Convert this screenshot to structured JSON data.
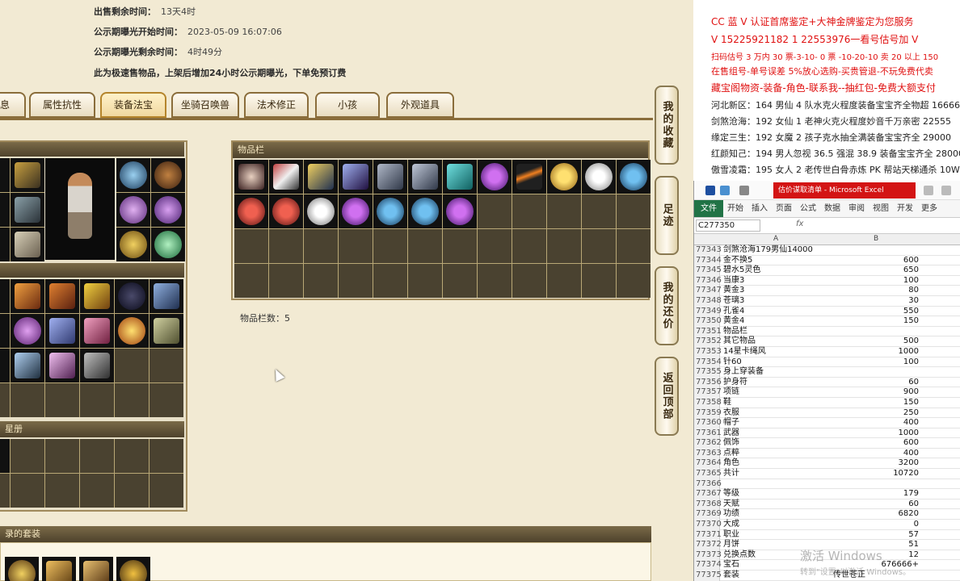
{
  "info": {
    "remain_label": "出售剩余时间：",
    "remain_value": "13天4时",
    "start_label": "公示期曝光开始时间：",
    "start_value": "2023-05-09 16:07:06",
    "left_label": "公示期曝光剩余时间：",
    "left_value": "4时49分",
    "note": "此为极速售物品，上架后增加24小时公示期曝光，下单免预订费"
  },
  "tabs": [
    "息",
    "属性抗性",
    "装备法宝",
    "坐骑召唤兽",
    "法术修正",
    "小孩",
    "外观道具"
  ],
  "active_tab": "装备法宝",
  "panels": {
    "items_title": "物品栏",
    "item_count": "物品栏数：5",
    "album_title": "星册",
    "suits_title": "录的套装"
  },
  "side_buttons": [
    "我的收藏",
    "足迹",
    "我的还价",
    "返回顶部"
  ],
  "ads": [
    {
      "text": "CC 蓝 V 认证首席鉴定+大神金牌鉴定为您服务",
      "color": "red"
    },
    {
      "text": "V 15225921182      1    22553976一看号估号加 V",
      "color": "red"
    },
    {
      "text": "扫码估号 3 万内 30 票-3-10-  0 票 -10-20-10  卖 20 以上 150",
      "color": "red"
    },
    {
      "text": "在售组号-单号误差 5%放心选购-买贵管退-不玩免费代卖",
      "color": "red"
    },
    {
      "text": "藏宝阁物资-装备-角色-联系我--抽红包-免费大额支付",
      "color": "red"
    },
    {
      "text": "河北新区：164 男仙 4 队水克火程度装备宝宝齐全物超 16666",
      "color": "dark"
    },
    {
      "text": "剑煞沧海：192 女仙 1 老神火克火程度妙音千万亲密 22555",
      "color": "dark"
    },
    {
      "text": "缘定三生：192 女魔 2 孩子克水抽全满装备宝宝齐全 29000",
      "color": "dark"
    },
    {
      "text": "红颜知己：194 男人忽视 36.5 强混 38.9 装备宝宝齐全 28000",
      "color": "dark"
    },
    {
      "text": "傲雪凌霜：195 女人 2 老传世白骨赤炼 PK 帮站天梯通杀 10W",
      "color": "dark"
    }
  ],
  "excel": {
    "title_bar": "估价谋取清单 - Microsoft Excel",
    "ribbon_tabs": [
      "文件",
      "开始",
      "插入",
      "页面",
      "公式",
      "数据",
      "审阅",
      "视图",
      "开发",
      "更多"
    ],
    "name_box": "C277350",
    "fx": "fx",
    "col_a": "A",
    "col_b": "B",
    "rows": [
      {
        "n": "77343",
        "a": "剑煞沧海179男仙14000",
        "b": ""
      },
      {
        "n": "77344",
        "a": "金不换5",
        "b": "600"
      },
      {
        "n": "77345",
        "a": "碧水5灵色",
        "b": "650"
      },
      {
        "n": "77346",
        "a": "当康3",
        "b": "100"
      },
      {
        "n": "77347",
        "a": "黄金3",
        "b": "80"
      },
      {
        "n": "77348",
        "a": "苍璃3",
        "b": "30"
      },
      {
        "n": "77349",
        "a": "孔雀4",
        "b": "550"
      },
      {
        "n": "77350",
        "a": "黄金4",
        "b": "150"
      },
      {
        "n": "77351",
        "a": "物品栏",
        "b": ""
      },
      {
        "n": "77352",
        "a": "其它物品",
        "b": "500"
      },
      {
        "n": "77353",
        "a": "14星卡绳风",
        "b": "1000"
      },
      {
        "n": "77354",
        "a": "针60",
        "b": "100"
      },
      {
        "n": "77355",
        "a": "身上穿装备",
        "b": ""
      },
      {
        "n": "77356",
        "a": "护身符",
        "b": "60"
      },
      {
        "n": "77357",
        "a": "项链",
        "b": "900"
      },
      {
        "n": "77358",
        "a": "鞋",
        "b": "150"
      },
      {
        "n": "77359",
        "a": "衣服",
        "b": "250"
      },
      {
        "n": "77360",
        "a": "帽子",
        "b": "400"
      },
      {
        "n": "77361",
        "a": "武器",
        "b": "1000"
      },
      {
        "n": "77362",
        "a": "佩饰",
        "b": "600"
      },
      {
        "n": "77363",
        "a": "点粹",
        "b": "400"
      },
      {
        "n": "77364",
        "a": "角色",
        "b": "3200"
      },
      {
        "n": "77365",
        "a": "共计",
        "b": "10720"
      },
      {
        "n": "77366",
        "a": "",
        "b": ""
      },
      {
        "n": "77367",
        "a": "等级",
        "b": "179"
      },
      {
        "n": "77368",
        "a": "天赋",
        "b": "60"
      },
      {
        "n": "77369",
        "a": "功绩",
        "b": "6820"
      },
      {
        "n": "77370",
        "a": "大成",
        "b": "0"
      },
      {
        "n": "77371",
        "a": "职业",
        "b": "57"
      },
      {
        "n": "77372",
        "a": "月饼",
        "b": "51"
      },
      {
        "n": "77373",
        "a": "兑换点数",
        "b": "12"
      },
      {
        "n": "77374",
        "a": "宝石",
        "b": "676666+"
      },
      {
        "n": "77375",
        "a": "套装",
        "b": "传世苍正"
      }
    ],
    "watermark": "激活 Windows",
    "watermark_sub": "转到\"设置\"以激活 Windows。"
  },
  "colors": {
    "accent": "#b5852c",
    "ad_red": "#e01010",
    "excel_green": "#217346"
  }
}
